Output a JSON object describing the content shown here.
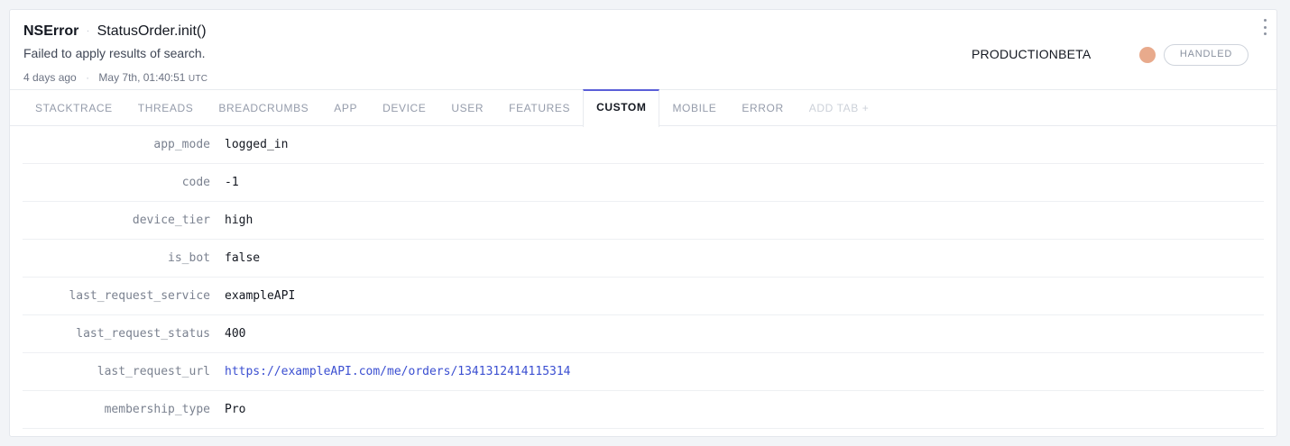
{
  "error": {
    "class": "NSError",
    "context": "StatusOrder.init()",
    "message": "Failed to apply results of search.",
    "relative_time": "4 days ago",
    "timestamp": "May 7th, 01:40:51",
    "timezone": "UTC"
  },
  "release_stage": "PRODUCTIONBETA",
  "severity_color": "#e8aa8c",
  "handled_label": "HANDLED",
  "accent_color": "#5b5fd8",
  "tabs": [
    {
      "label": "STACKTRACE"
    },
    {
      "label": "THREADS"
    },
    {
      "label": "BREADCRUMBS"
    },
    {
      "label": "APP"
    },
    {
      "label": "DEVICE"
    },
    {
      "label": "USER"
    },
    {
      "label": "FEATURES"
    },
    {
      "label": "CUSTOM"
    },
    {
      "label": "MOBILE"
    },
    {
      "label": "ERROR"
    },
    {
      "label": "ADD TAB +"
    }
  ],
  "active_tab": "CUSTOM",
  "custom": [
    {
      "key": "app_mode",
      "value": "logged_in"
    },
    {
      "key": "code",
      "value": "-1"
    },
    {
      "key": "device_tier",
      "value": "high"
    },
    {
      "key": "is_bot",
      "value": "false"
    },
    {
      "key": "last_request_service",
      "value": "exampleAPI"
    },
    {
      "key": "last_request_status",
      "value": "400"
    },
    {
      "key": "last_request_url",
      "value": "https://exampleAPI.com/me/orders/1341312414115314"
    },
    {
      "key": "membership_type",
      "value": "Pro"
    }
  ]
}
